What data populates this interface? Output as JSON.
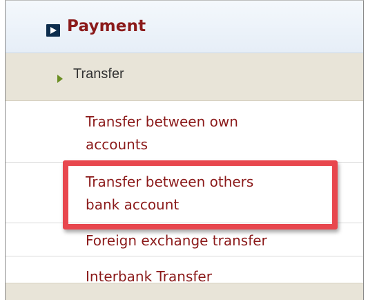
{
  "menu": {
    "header": {
      "title": "Payment",
      "icon": "play-square-icon"
    },
    "submenu": {
      "label": "Transfer",
      "icon": "caret-right-icon"
    },
    "items": [
      {
        "label": "Transfer between own\naccounts"
      },
      {
        "label": "Transfer between others\nbank account"
      },
      {
        "label": "Foreign exchange transfer"
      },
      {
        "label": "Interbank Transfer"
      }
    ]
  },
  "colors": {
    "title": "#8b1a1a",
    "link": "#8b1a1a",
    "header_icon": "#0d2d4d",
    "submenu_bg": "#e8e4d8",
    "highlight": "#e8474e",
    "submenu_arrow": "#6b8e23"
  }
}
